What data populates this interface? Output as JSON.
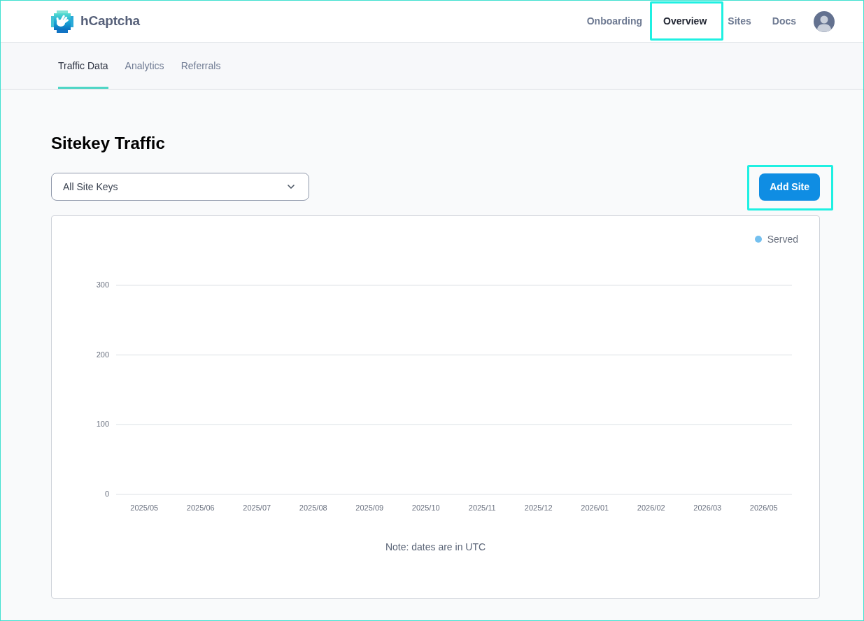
{
  "header": {
    "logo": {
      "text": "hCaptcha"
    },
    "nav": [
      {
        "label": "Onboarding",
        "selected": false,
        "highlighted": false
      },
      {
        "label": "Overview",
        "selected": true,
        "highlighted": true
      },
      {
        "label": "Sites",
        "selected": false,
        "highlighted": false
      },
      {
        "label": "Docs",
        "selected": false,
        "highlighted": false
      }
    ]
  },
  "tabs": [
    {
      "label": "Traffic Data",
      "selected": true
    },
    {
      "label": "Analytics",
      "selected": false
    },
    {
      "label": "Referrals",
      "selected": false
    }
  ],
  "page_title": "Sitekey Traffic",
  "site_key_select": {
    "value": "All Site Keys"
  },
  "add_site_button": {
    "label": "Add Site",
    "highlighted": true
  },
  "chart": {
    "chart_data": {
      "type": "line",
      "categories": [
        "2025/05",
        "2025/06",
        "2025/07",
        "2025/08",
        "2025/09",
        "2025/10",
        "2025/11",
        "2025/12",
        "2026/01",
        "2026/02",
        "2026/03",
        "2026/05"
      ],
      "ylim": [
        0,
        300
      ],
      "yticks": [
        0,
        100,
        200,
        300
      ],
      "series": [
        {
          "name": "Served",
          "color": "#74c0ef",
          "values": [
            null,
            null,
            null,
            null,
            null,
            null,
            null,
            null,
            null,
            null,
            null,
            null
          ]
        }
      ]
    },
    "note": "Note: dates are in UTC"
  }
}
